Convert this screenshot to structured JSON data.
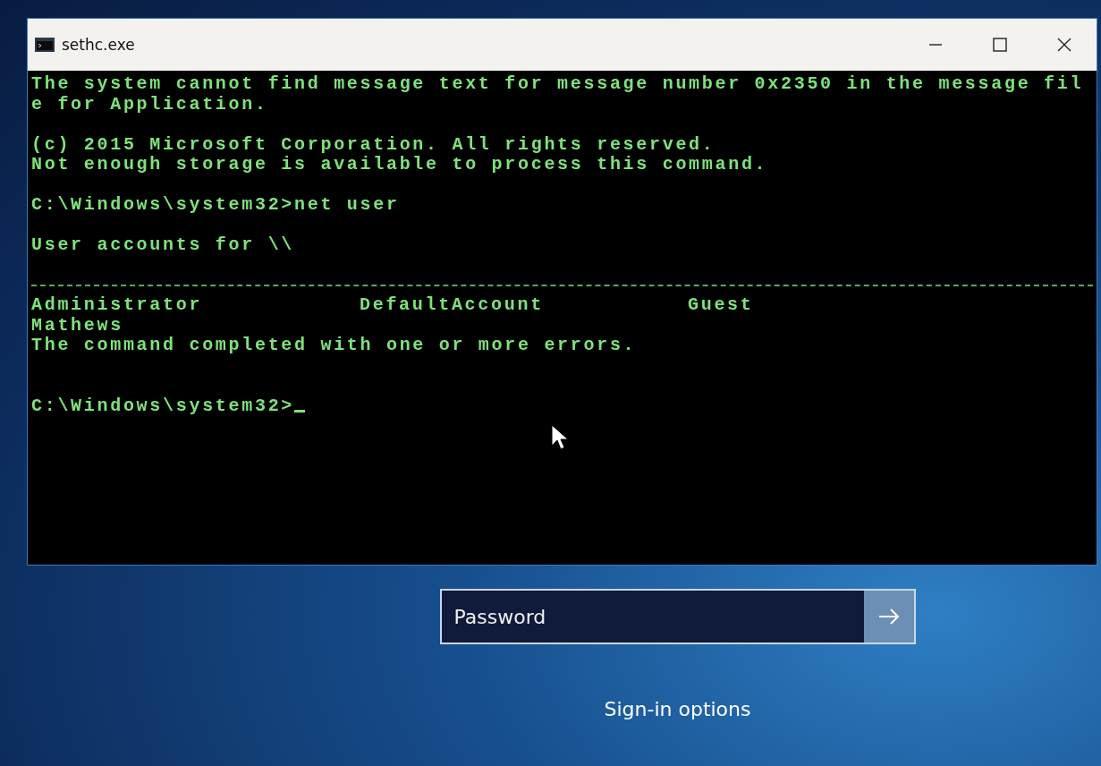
{
  "window": {
    "title": "sethc.exe"
  },
  "console": {
    "lines": [
      {
        "kind": "text",
        "text": "The system cannot find message text for message number 0x2350 in the message fil"
      },
      {
        "kind": "text",
        "text": "e for Application."
      },
      {
        "kind": "blank"
      },
      {
        "kind": "text",
        "text": "(c) 2015 Microsoft Corporation. All rights reserved."
      },
      {
        "kind": "text",
        "text": "Not enough storage is available to process this command."
      },
      {
        "kind": "blank"
      },
      {
        "kind": "text",
        "text": "C:\\Windows\\system32>net user"
      },
      {
        "kind": "blank"
      },
      {
        "kind": "text",
        "text": "User accounts for \\\\"
      },
      {
        "kind": "blank"
      },
      {
        "kind": "rule"
      },
      {
        "kind": "columns",
        "cells": [
          "Administrator",
          "DefaultAccount",
          "Guest"
        ]
      },
      {
        "kind": "text",
        "text": "Mathews"
      },
      {
        "kind": "text",
        "text": "The command completed with one or more errors."
      },
      {
        "kind": "blank"
      },
      {
        "kind": "blank"
      },
      {
        "kind": "prompt",
        "text": "C:\\Windows\\system32>"
      }
    ]
  },
  "password": {
    "placeholder": "Password"
  },
  "sign_in_options": "Sign-in options"
}
